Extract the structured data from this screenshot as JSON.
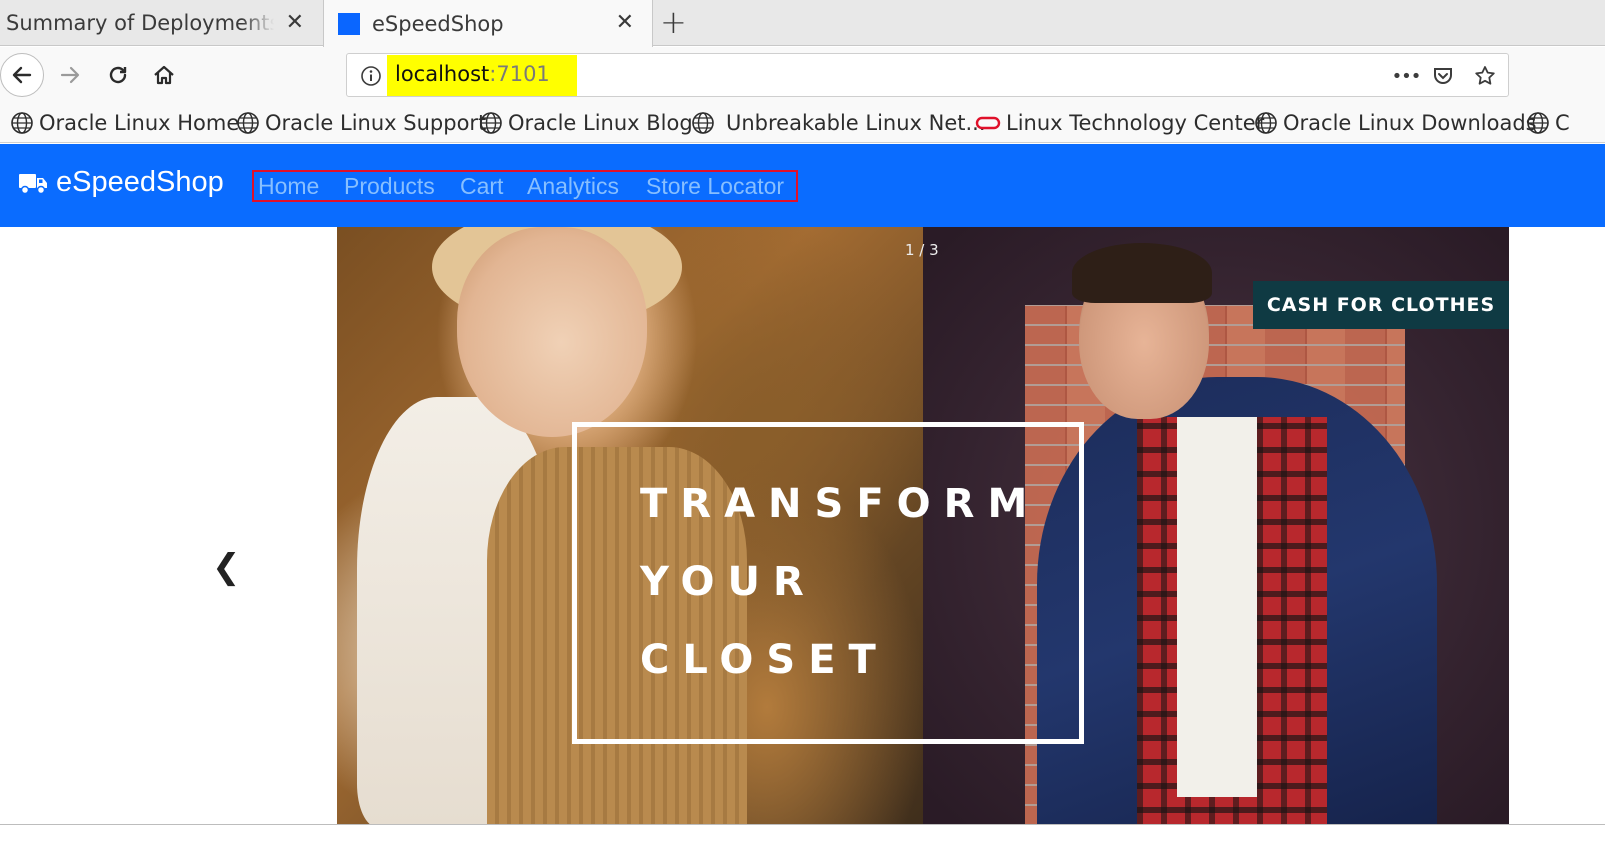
{
  "browser": {
    "tabs": [
      {
        "title": "Summary of Deployments - W",
        "active": false
      },
      {
        "title": "eSpeedShop",
        "active": true
      }
    ],
    "close_glyph": "✕",
    "new_tab_glyph": "+",
    "address": {
      "host": "localhost",
      "port": ":7101",
      "highlight_color": "#ffff00"
    },
    "toolbar_icons": [
      "back-arrow-icon",
      "forward-arrow-icon",
      "reload-icon",
      "home-icon",
      "info-icon",
      "more-icon",
      "pocket-icon",
      "star-icon"
    ],
    "more_glyph": "•••",
    "bookmarks": [
      {
        "label": "Oracle Linux Home",
        "icon": "globe-icon"
      },
      {
        "label": "Oracle Linux Support",
        "icon": "globe-icon"
      },
      {
        "label": "Oracle Linux Blog",
        "icon": "globe-icon"
      },
      {
        "label": "Unbreakable Linux Net...",
        "icon": "globe-icon"
      },
      {
        "label": "Linux Technology Center",
        "icon": "oracle-ring-icon"
      },
      {
        "label": "Oracle Linux Downloads",
        "icon": "globe-icon"
      },
      {
        "label": "C",
        "icon": "globe-icon"
      }
    ]
  },
  "site": {
    "brand": "eSpeedShop",
    "brand_icon": "truck-icon",
    "header_color": "#0a6cff",
    "nav": [
      {
        "label": "Home"
      },
      {
        "label": "Products"
      },
      {
        "label": "Cart"
      },
      {
        "label": "Analytics"
      },
      {
        "label": "Store Locator"
      }
    ],
    "nav_highlight_color": "#e0102a",
    "carousel": {
      "counter": "1 / 3",
      "prev_glyph": "❮",
      "headline": [
        "TRANSFORM",
        "YOUR",
        "CLOSET"
      ],
      "badge": "CASH FOR CLOTHES"
    }
  }
}
